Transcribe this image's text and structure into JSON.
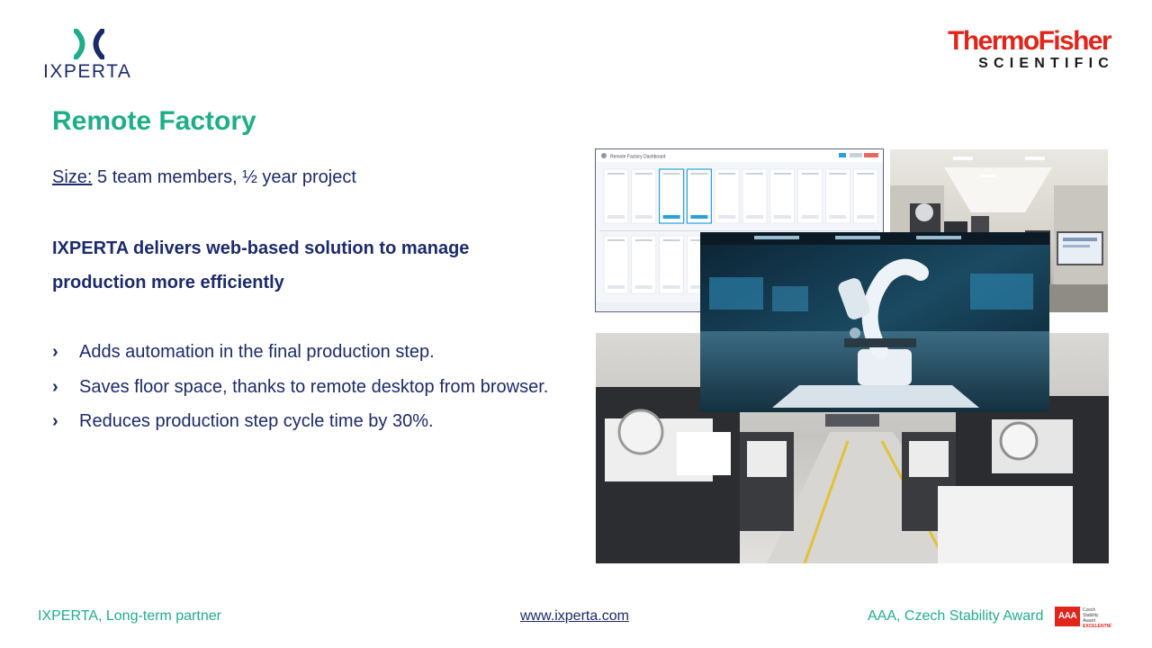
{
  "header": {
    "ixperta_logo_text": "IXPERTA",
    "partner_logo_line1": "ThermoFisher",
    "partner_logo_line2": "SCIENTIFIC"
  },
  "slide": {
    "title": "Remote Factory",
    "size_label": "Size:",
    "size_value": " 5 team members, ½ year project",
    "headline": "IXPERTA delivers web-based solution to manage production more efficiently",
    "bullets": [
      "Adds automation in the final production step.",
      "Saves floor space, thanks to remote desktop from browser.",
      "Reduces production step cycle time by 30%."
    ],
    "bullet_icon": "chevron-right-icon"
  },
  "dashboard_screenshot": {
    "app_title": "Remote Factory Dashboard"
  },
  "footer": {
    "left": "IXPERTA, Long-term partner",
    "link": "www.ixperta.com",
    "right": "AAA, Czech Stability Award",
    "badge_main": "AAA",
    "badge_small_1": "Czech",
    "badge_small_2": "Stability Award",
    "badge_small_3": "EXCELENTNÍ"
  },
  "colors": {
    "accent_green": "#1fae8a",
    "navy": "#1b2a6b",
    "brand_red": "#e1251b"
  }
}
